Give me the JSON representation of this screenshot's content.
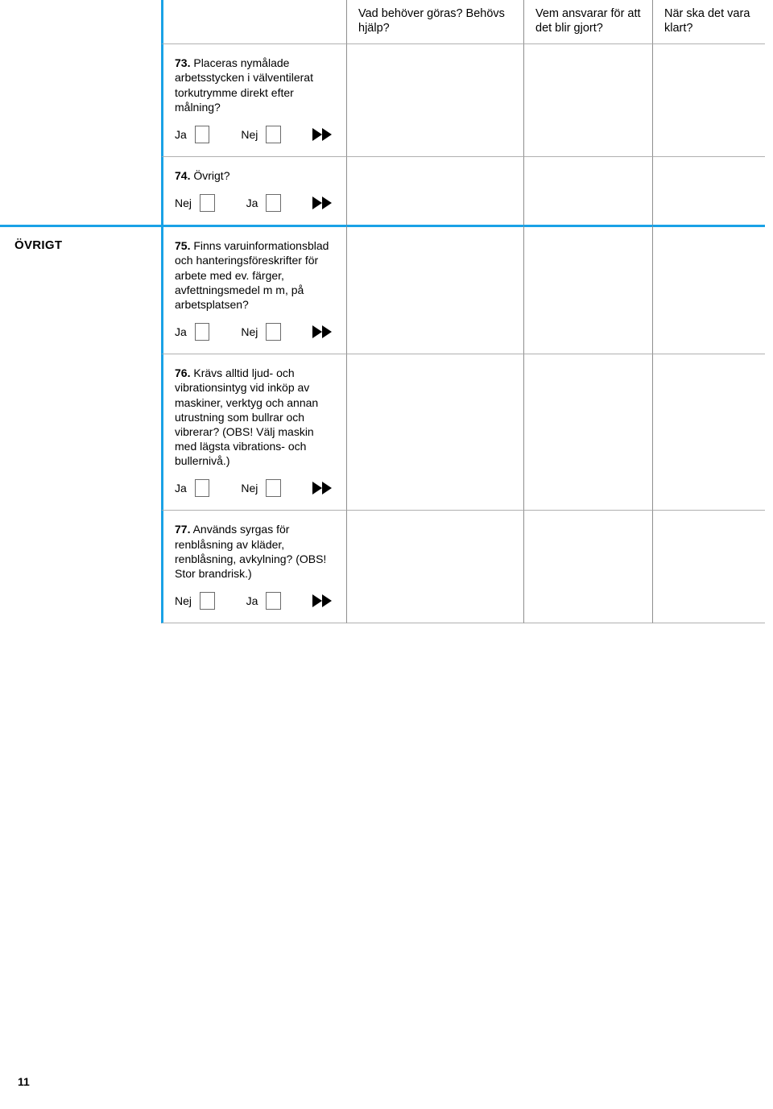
{
  "headers": {
    "col1": "Vad behöver göras? Behövs hjälp?",
    "col2": "Vem ansvarar för att det blir gjort?",
    "col3": "När ska det vara klart?"
  },
  "section": "ÖVRIGT",
  "labels": {
    "ja": "Ja",
    "nej": "Nej"
  },
  "q73": {
    "num": "73.",
    "text": "Placeras nymålade arbetsstycken i välventilerat torkutrymme direkt efter målning?"
  },
  "q74": {
    "num": "74.",
    "text": "Övrigt?"
  },
  "q75": {
    "num": "75.",
    "text": "Finns varuinformationsblad och hanteringsföreskrifter för arbete med ev. färger, avfettningsmedel m m, på arbetsplatsen?"
  },
  "q76": {
    "num": "76.",
    "text": "Krävs alltid ljud- och vibrationsintyg vid inköp av maskiner, verktyg och annan utrustning som bullrar och vibrerar? (OBS! Välj maskin med lägsta vibrations- och bullernivå.)"
  },
  "q77": {
    "num": "77.",
    "text": "Används syrgas för renblåsning av kläder, renblåsning, avkylning? (OBS! Stor brandrisk.)"
  },
  "pageNumber": "11"
}
